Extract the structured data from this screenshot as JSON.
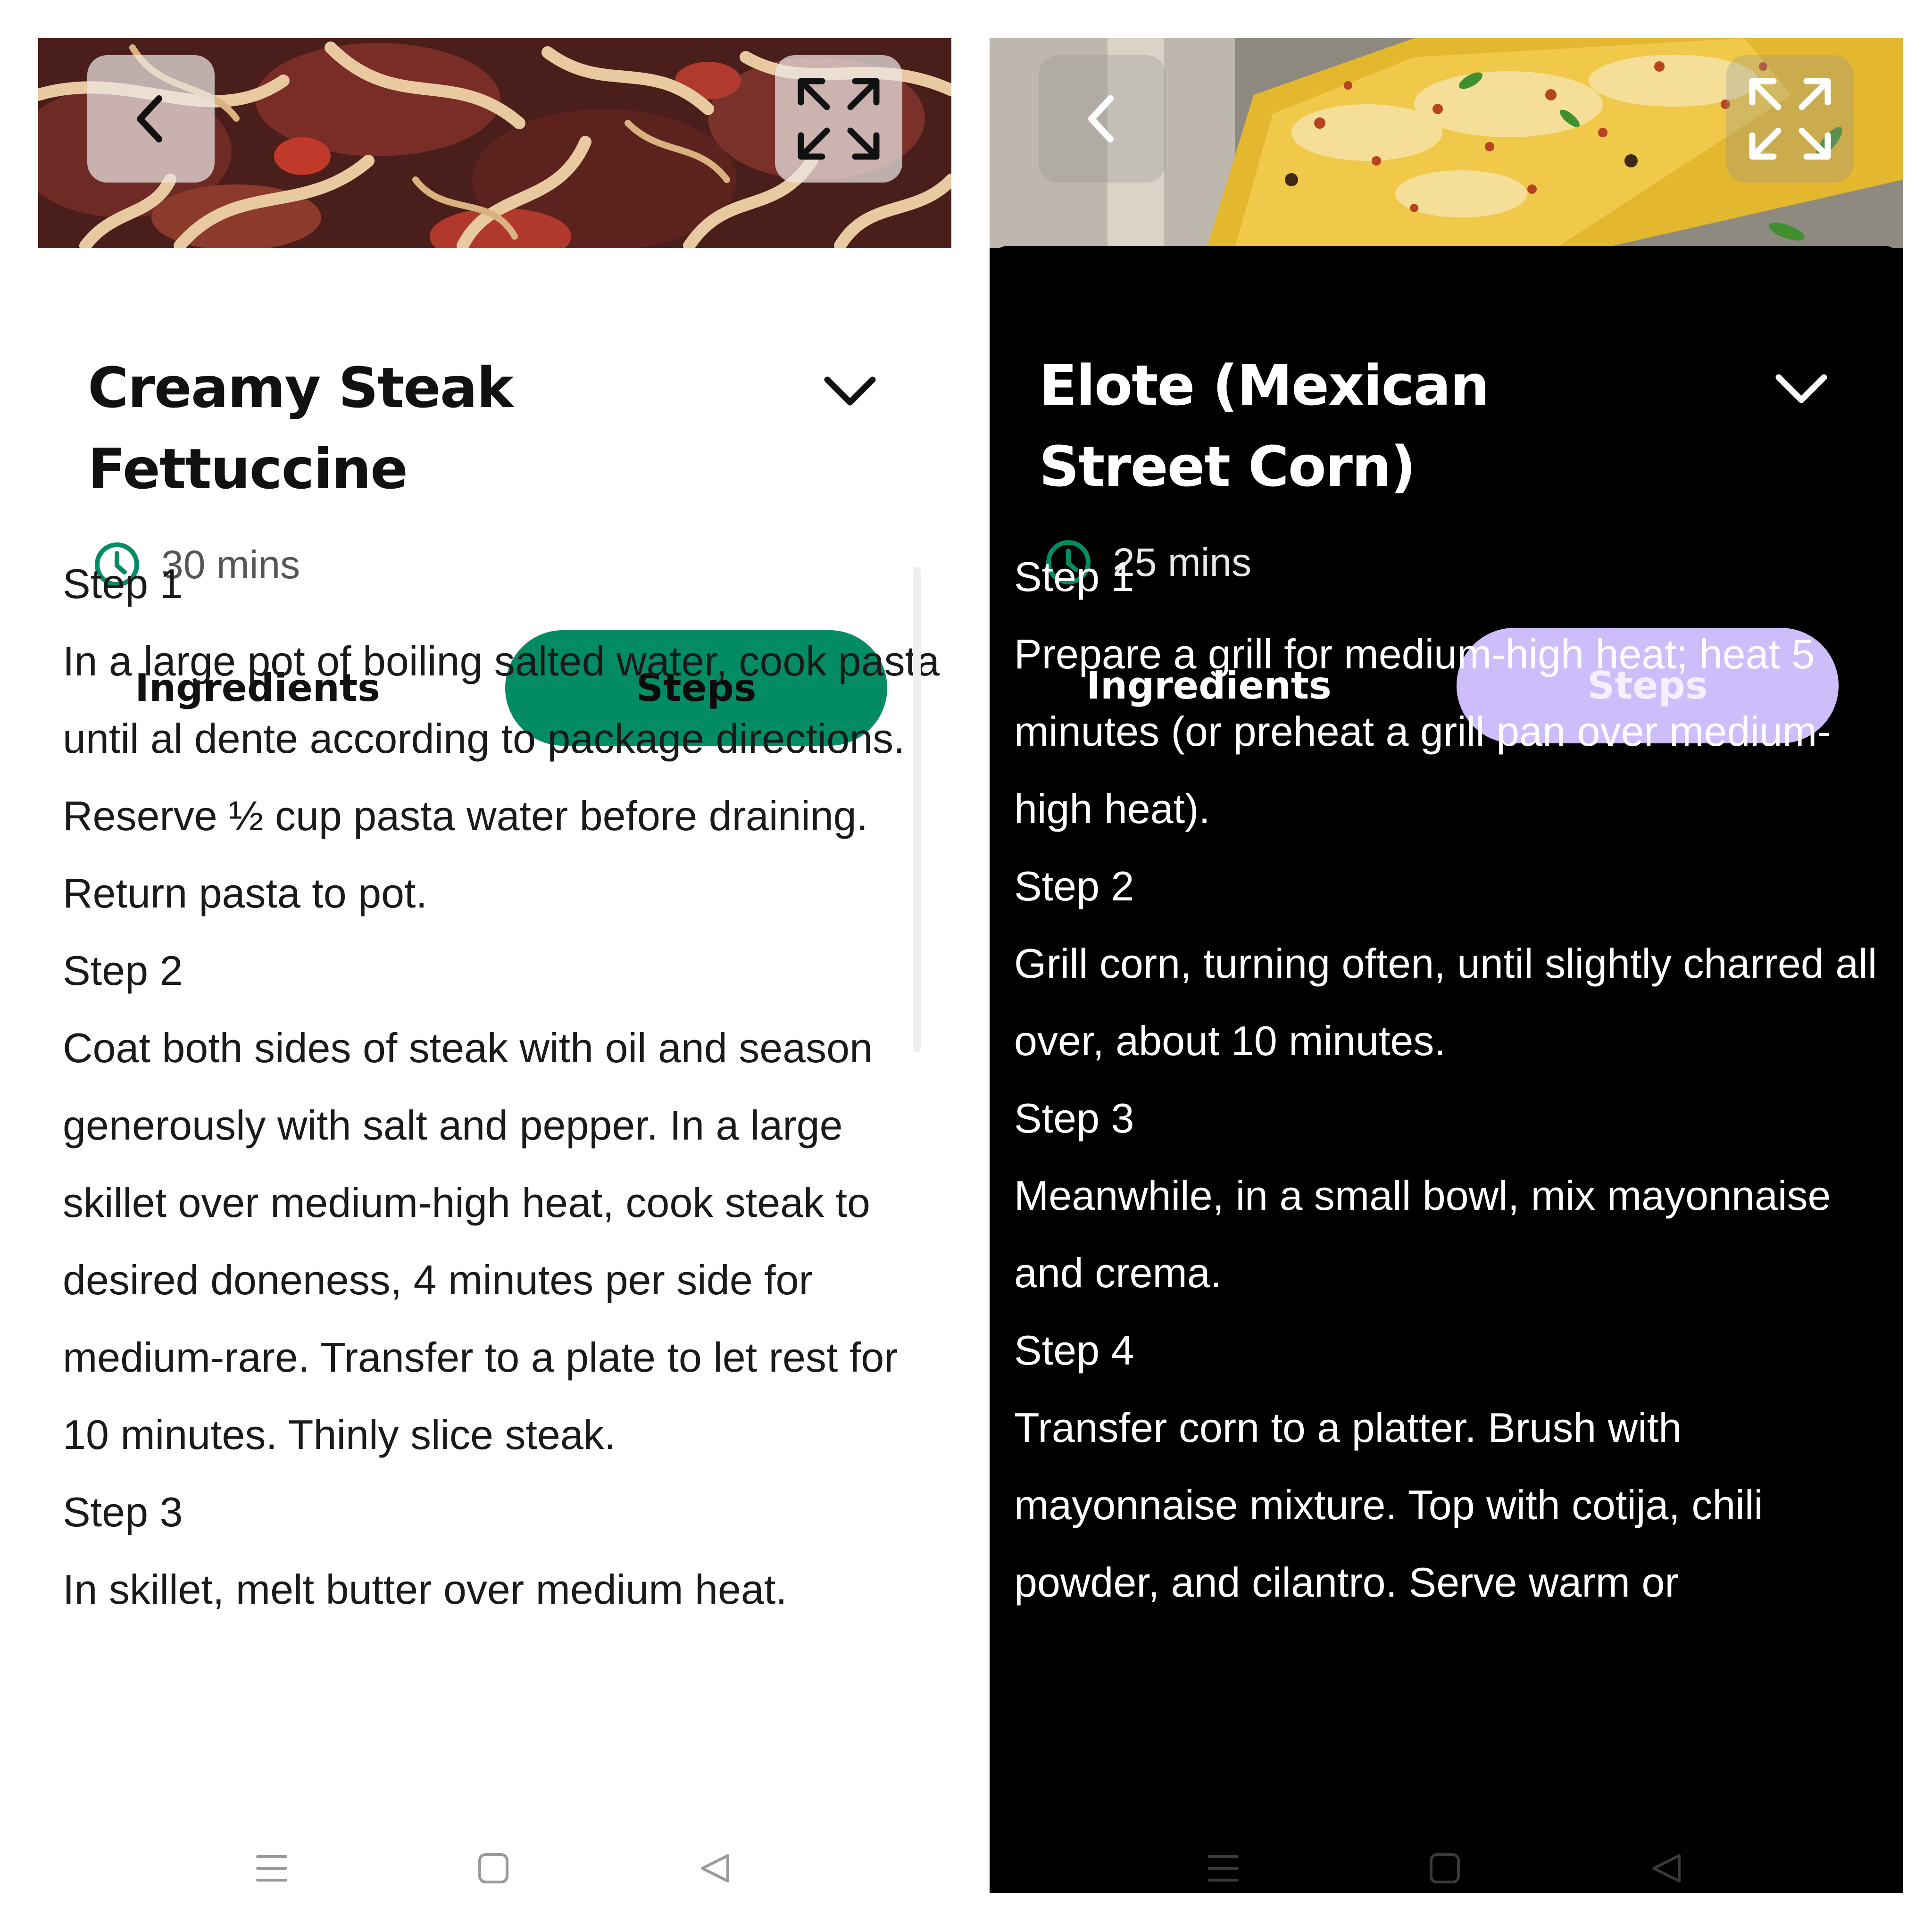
{
  "screens": [
    {
      "theme": "light",
      "accent": "#038c63",
      "hero_image": "steak-fettuccine-photo",
      "title": "Creamy Steak Fettuccine",
      "time": "30 mins",
      "tabs": {
        "ingredients": "Ingredients",
        "steps": "Steps",
        "active": "steps"
      },
      "steps": [
        {
          "heading": "Step 1",
          "text": "In a large pot of boiling salted water, cook pasta until al dente according to package directions. Reserve ½ cup pasta water before draining. Return pasta to pot."
        },
        {
          "heading": "Step 2",
          "text": "Coat both sides of steak with oil and season generously with salt and pepper. In a large skillet over medium-high heat, cook steak to desired doneness, 4 minutes per side for medium-rare. Transfer to a plate to let rest for 10 minutes. Thinly slice steak."
        },
        {
          "heading": "Step 3",
          "text": "In skillet, melt butter over medium heat."
        }
      ]
    },
    {
      "theme": "dark",
      "accent": "#cdbdfb",
      "hero_image": "grilled-corn-photo",
      "title": "Elote (Mexican Street Corn)",
      "time": "25 mins",
      "tabs": {
        "ingredients": "Ingredients",
        "steps": "Steps",
        "active": "steps"
      },
      "steps": [
        {
          "heading": "Step 1",
          "text": "Prepare a grill for medium-high heat; heat 5 minutes (or preheat a grill pan over medium-high heat)."
        },
        {
          "heading": "Step 2",
          "text": "Grill corn, turning often, until slightly charred all over, about 10 minutes."
        },
        {
          "heading": "Step 3",
          "text": "Meanwhile, in a small bowl, mix mayonnaise and crema."
        },
        {
          "heading": "Step 4",
          "text": "Transfer corn to a platter. Brush with mayonnaise mixture. Top with cotija, chili powder, and cilantro. Serve warm or"
        }
      ]
    }
  ],
  "icons": {
    "back": "chevron-left-icon",
    "expand": "expand-icon",
    "collapse": "chevron-down-icon",
    "time": "clock-icon",
    "nav_menu": "menu-icon",
    "nav_home": "home-icon",
    "nav_back": "back-triangle-icon"
  }
}
